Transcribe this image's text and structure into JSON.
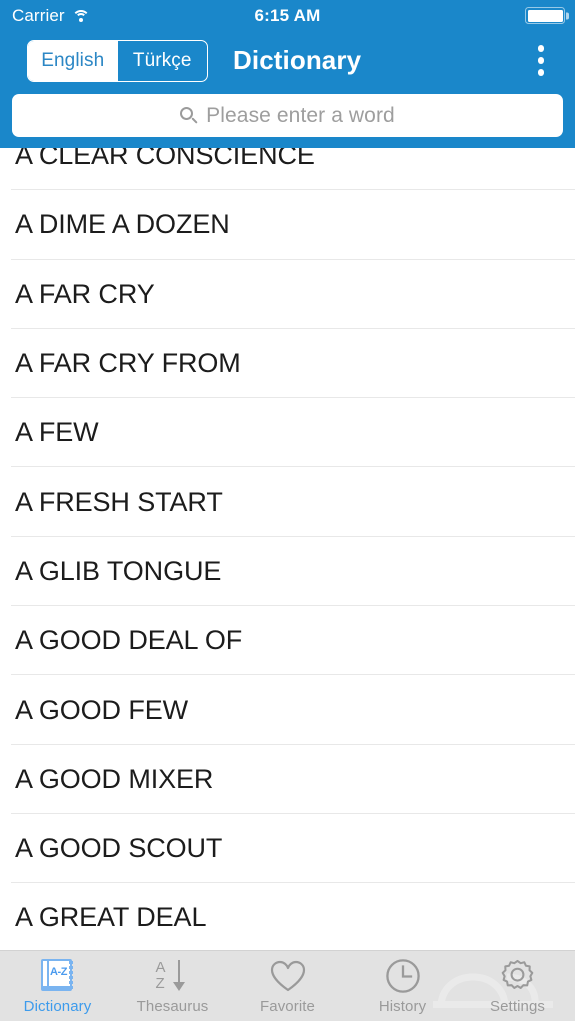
{
  "status_bar": {
    "carrier": "Carrier",
    "wifi_icon": "wifi-icon",
    "time": "6:15 AM",
    "battery_icon": "battery-full-icon"
  },
  "navbar": {
    "title": "Dictionary",
    "language_segments": [
      {
        "label": "English",
        "selected": true
      },
      {
        "label": "Türkçe",
        "selected": false
      }
    ],
    "overflow_icon": "overflow-menu-icon"
  },
  "search": {
    "placeholder": "Please enter a word",
    "value": "",
    "icon": "search-icon"
  },
  "word_list": {
    "items": [
      {
        "label": "A CLEAR CONSCIENCE"
      },
      {
        "label": "A DIME A DOZEN"
      },
      {
        "label": "A FAR CRY"
      },
      {
        "label": "A FAR CRY FROM"
      },
      {
        "label": "A FEW"
      },
      {
        "label": "A FRESH START"
      },
      {
        "label": "A GLIB TONGUE"
      },
      {
        "label": "A GOOD DEAL OF"
      },
      {
        "label": "A GOOD FEW"
      },
      {
        "label": "A GOOD MIXER"
      },
      {
        "label": "A GOOD SCOUT"
      },
      {
        "label": "A GREAT DEAL"
      }
    ]
  },
  "tabbar": {
    "tabs": [
      {
        "label": "Dictionary",
        "icon": "dictionary-book-icon",
        "active": true
      },
      {
        "label": "Thesaurus",
        "icon": "az-sort-arrow-icon",
        "active": false
      },
      {
        "label": "Favorite",
        "icon": "heart-icon",
        "active": false
      },
      {
        "label": "History",
        "icon": "clock-icon",
        "active": false
      },
      {
        "label": "Settings",
        "icon": "gear-icon",
        "active": false
      }
    ]
  },
  "colors": {
    "header_blue": "#1a87ca",
    "accent_blue": "#3d9bec",
    "tabbar_bg": "#e2e2e2",
    "inactive_gray": "#9a9a9a",
    "separator": "#e8e8e8",
    "text": "#1c1c1c"
  }
}
